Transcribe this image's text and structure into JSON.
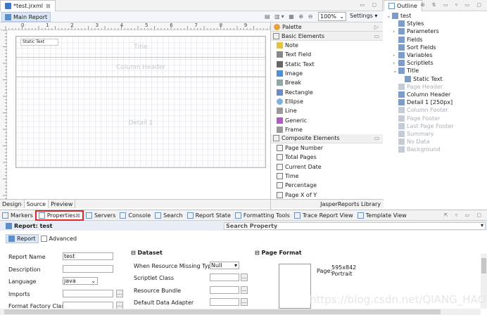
{
  "editor": {
    "file_tab": "*test.jrxml",
    "sub_tab": "Main Report",
    "zoom": "100%",
    "settings_label": "Settings",
    "ruler_numbers": [
      "0",
      "1",
      "2",
      "3",
      "4",
      "5",
      "6",
      "7",
      "8",
      "9"
    ],
    "bands": {
      "static_text": "Static Text",
      "title": "Title",
      "column_header": "Column Header",
      "detail": "Detail 1"
    },
    "bottom_tabs": [
      "Design",
      "Source",
      "Preview"
    ]
  },
  "palette": {
    "title": "Palette",
    "basic_group": "Basic Elements",
    "basic_items": [
      "Note",
      "Text Field",
      "Static Text",
      "Image",
      "Break",
      "Rectangle",
      "Ellipse",
      "Line",
      "Generic",
      "Frame"
    ],
    "composite_group": "Composite Elements",
    "composite_items": [
      "Page Number",
      "Total Pages",
      "Current Date",
      "Time",
      "Percentage",
      "Page X of Y"
    ],
    "footer": "JasperReports Library"
  },
  "outline": {
    "title": "Outline",
    "items": [
      {
        "label": "test",
        "level": 0,
        "dim": false,
        "arrow": "v"
      },
      {
        "label": "Styles",
        "level": 1,
        "dim": false,
        "arrow": ""
      },
      {
        "label": "Parameters",
        "level": 1,
        "dim": false,
        "arrow": ">"
      },
      {
        "label": "Fields",
        "level": 1,
        "dim": false,
        "arrow": ""
      },
      {
        "label": "Sort Fields",
        "level": 1,
        "dim": false,
        "arrow": ""
      },
      {
        "label": "Variables",
        "level": 1,
        "dim": false,
        "arrow": ">"
      },
      {
        "label": "Scriptlets",
        "level": 1,
        "dim": false,
        "arrow": ">"
      },
      {
        "label": "Title",
        "level": 1,
        "dim": false,
        "arrow": "v"
      },
      {
        "label": "Static Text",
        "level": 2,
        "dim": false,
        "arrow": ""
      },
      {
        "label": "Page Header",
        "level": 1,
        "dim": true,
        "arrow": ""
      },
      {
        "label": "Column Header",
        "level": 1,
        "dim": false,
        "arrow": ""
      },
      {
        "label": "Detail 1 [250px]",
        "level": 1,
        "dim": false,
        "arrow": ""
      },
      {
        "label": "Column Footer",
        "level": 1,
        "dim": true,
        "arrow": ""
      },
      {
        "label": "Page Footer",
        "level": 1,
        "dim": true,
        "arrow": ""
      },
      {
        "label": "Last Page Footer",
        "level": 1,
        "dim": true,
        "arrow": ""
      },
      {
        "label": "Summary",
        "level": 1,
        "dim": true,
        "arrow": ""
      },
      {
        "label": "No Data",
        "level": 1,
        "dim": true,
        "arrow": ""
      },
      {
        "label": "Background",
        "level": 1,
        "dim": true,
        "arrow": ""
      }
    ]
  },
  "views": {
    "tabs": [
      "Markers",
      "Properties",
      "Servers",
      "Console",
      "Search",
      "Report State",
      "Formatting Tools",
      "Trace Report View",
      "Template View"
    ],
    "selected": "Properties"
  },
  "properties": {
    "header": "Report: test",
    "search_placeholder": "Search Property",
    "subtabs": [
      "Report",
      "Advanced"
    ],
    "fields": [
      {
        "label": "Report Name",
        "value": "test"
      },
      {
        "label": "Description",
        "value": ""
      },
      {
        "label": "Language",
        "value": "java"
      },
      {
        "label": "Imports",
        "value": ""
      },
      {
        "label": "Format Factory Class",
        "value": ""
      }
    ],
    "dataset": {
      "title": "Dataset",
      "missing_label": "When Resource Missing Type",
      "missing_value": "Null",
      "scriptlet_label": "Scriptlet Class",
      "bundle_label": "Resource Bundle",
      "adapter_label": "Default Data Adapter"
    },
    "page_format": {
      "title": "Page Format",
      "page_label": "Page:",
      "size": "595x842",
      "orientation": "Portrait"
    }
  },
  "watermark": "https://blog.csdn.net/QIANG_HAO"
}
